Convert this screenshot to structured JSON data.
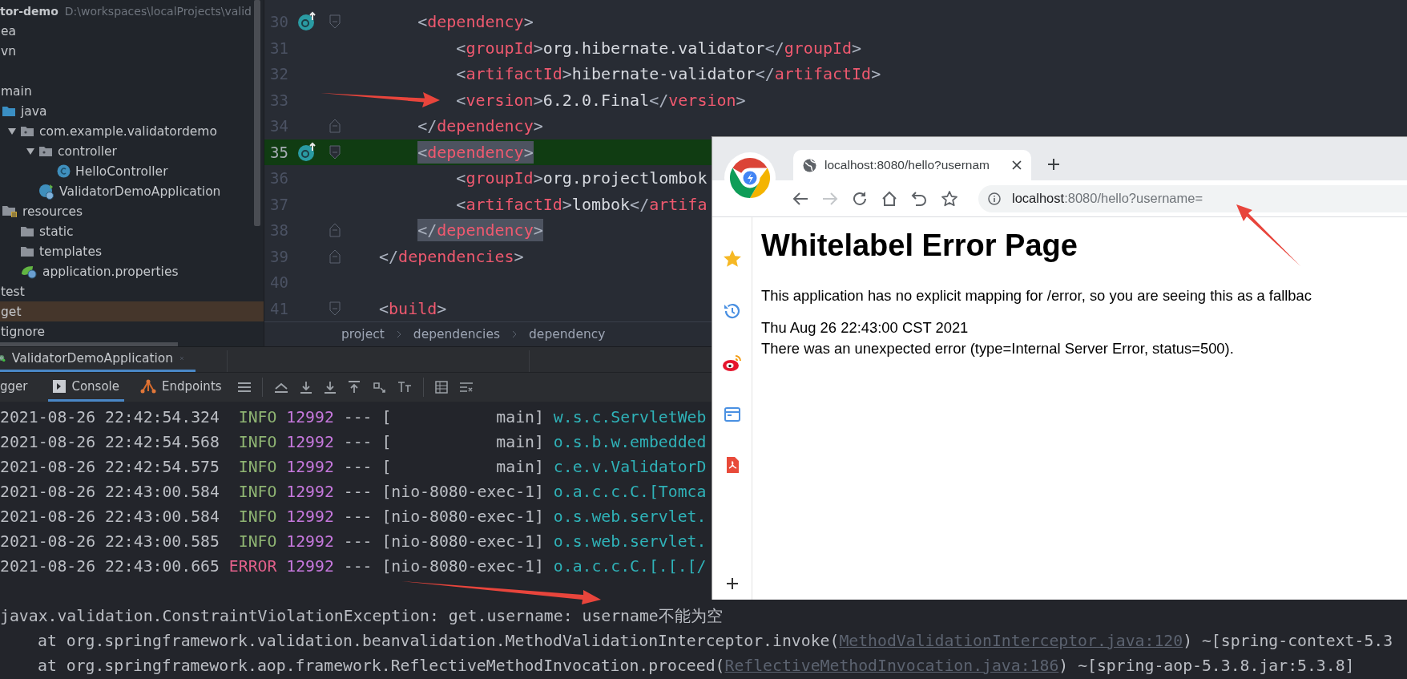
{
  "project": {
    "name": "tor-demo",
    "path": "D:\\workspaces\\localProjects\\valid",
    "tree": [
      {
        "label": "ea",
        "selected": false
      },
      {
        "label": "vn",
        "selected": false
      },
      {
        "label": "main",
        "selected": false,
        "children": [
          {
            "label": "java",
            "kind": "source",
            "selected": false,
            "children": [
              {
                "label": "com.example.validatordemo",
                "kind": "package",
                "expanded": true,
                "selected": false,
                "children": [
                  {
                    "label": "controller",
                    "kind": "package",
                    "expanded": true,
                    "selected": false,
                    "children": [
                      {
                        "label": "HelloController",
                        "kind": "class",
                        "selected": false
                      }
                    ]
                  },
                  {
                    "label": "ValidatorDemoApplication",
                    "kind": "app",
                    "selected": false
                  }
                ]
              }
            ]
          },
          {
            "label": "resources",
            "kind": "resources",
            "selected": false,
            "children": [
              {
                "label": "static",
                "kind": "folder",
                "selected": false
              },
              {
                "label": "templates",
                "kind": "folder",
                "selected": false
              },
              {
                "label": "application.properties",
                "kind": "props",
                "selected": false
              }
            ]
          }
        ]
      },
      {
        "label": "test",
        "selected": false
      },
      {
        "label": "get",
        "selected": true
      },
      {
        "label": "tignore",
        "selected": false
      }
    ]
  },
  "editor": {
    "lines": [
      {
        "number": "30",
        "code": "    <dependency>",
        "gutter_icon": true,
        "kind": "open",
        "current": false,
        "matched": false
      },
      {
        "number": "31",
        "code": "        <groupId>org.hibernate.validator</groupId>",
        "gutter_icon": false,
        "current": false,
        "matched": false
      },
      {
        "number": "32",
        "code": "        <artifactId>hibernate-validator</artifactId>",
        "gutter_icon": false,
        "current": false,
        "matched": false
      },
      {
        "number": "33",
        "code": "        <version>6.2.0.Final</version>",
        "gutter_icon": false,
        "current": false,
        "matched": false
      },
      {
        "number": "34",
        "code": "    </dependency>",
        "gutter_icon": false,
        "kind": "close",
        "current": false,
        "matched": false
      },
      {
        "number": "35",
        "code": "    <dependency>",
        "gutter_icon": true,
        "kind": "open",
        "current": true,
        "matched": true
      },
      {
        "number": "36",
        "code": "        <groupId>org.projectlombok",
        "gutter_icon": false,
        "current": false,
        "matched": false
      },
      {
        "number": "37",
        "code": "        <artifactId>lombok</artifa",
        "gutter_icon": false,
        "current": false,
        "matched": false
      },
      {
        "number": "38",
        "code": "    </dependency>",
        "gutter_icon": false,
        "kind": "close",
        "current": false,
        "matched": true
      },
      {
        "number": "39",
        "code": "</dependencies>",
        "gutter_icon": false,
        "kind": "close",
        "current": false,
        "matched": false
      },
      {
        "number": "40",
        "gutter_icon": false,
        "current": false
      },
      {
        "number": "41",
        "code": "<build>",
        "gutter_icon": false,
        "kind": "open",
        "current": false,
        "matched": false
      }
    ],
    "breadcrumb": [
      "project",
      "dependencies",
      "dependency"
    ]
  },
  "run_panel": {
    "tabs": [
      {
        "label": "ValidatorDemoApplication",
        "selected": true
      }
    ],
    "tool_tabs": [
      {
        "label": "gger",
        "kind": "debugger",
        "selected": false
      },
      {
        "label": "Console",
        "kind": "console",
        "selected": true
      },
      {
        "label": "Endpoints",
        "kind": "endpoints",
        "selected": false
      }
    ]
  },
  "console": {
    "log": [
      {
        "time": "2021-08-26 22:42:54.324",
        "level": "INFO",
        "kind": "info",
        "pid": "12992",
        "sep": "---",
        "thread": "[           main]",
        "logger": "w.s.c.ServletWeb"
      },
      {
        "time": "2021-08-26 22:42:54.568",
        "level": "INFO",
        "kind": "info",
        "pid": "12992",
        "sep": "---",
        "thread": "[           main]",
        "logger": "o.s.b.w.embedded"
      },
      {
        "time": "2021-08-26 22:42:54.575",
        "level": "INFO",
        "kind": "info",
        "pid": "12992",
        "sep": "---",
        "thread": "[           main]",
        "logger": "c.e.v.ValidatorD"
      },
      {
        "time": "2021-08-26 22:43:00.584",
        "level": "INFO",
        "kind": "info",
        "pid": "12992",
        "sep": "---",
        "thread": "[nio-8080-exec-1]",
        "logger": "o.a.c.c.C.[Tomca"
      },
      {
        "time": "2021-08-26 22:43:00.584",
        "level": "INFO",
        "kind": "info",
        "pid": "12992",
        "sep": "---",
        "thread": "[nio-8080-exec-1]",
        "logger": "o.s.web.servlet."
      },
      {
        "time": "2021-08-26 22:43:00.585",
        "level": "INFO",
        "kind": "info",
        "pid": "12992",
        "sep": "---",
        "thread": "[nio-8080-exec-1]",
        "logger": "o.s.web.servlet."
      },
      {
        "time": "2021-08-26 22:43:00.665",
        "level": "ERROR",
        "kind": "error",
        "pid": "12992",
        "sep": "---",
        "thread": "[nio-8080-exec-1]",
        "logger": "o.a.c.c.C.[.[.[/"
      }
    ],
    "trace": [
      {
        "kind": "exception",
        "text": "javax.validation.ConstraintViolationException: get.username: username不能为空"
      },
      {
        "kind": "frame",
        "text": "at org.springframework.validation.beanvalidation.MethodValidationInterceptor.invoke(",
        "link": "MethodValidationInterceptor.java:120",
        "rest": ") ~[spring-context-5.3"
      },
      {
        "kind": "frame",
        "text": "at org.springframework.aop.framework.ReflectiveMethodInvocation.proceed(",
        "link": "ReflectiveMethodInvocation.java:186",
        "rest": ") ~[spring-aop-5.3.8.jar:5.3.8]"
      }
    ]
  },
  "browser": {
    "tab": {
      "title": "localhost:8080/hello?usernam",
      "selected": true
    },
    "forward_enabled": false,
    "address": {
      "host": "localhost",
      "path": ":8080/hello?username="
    },
    "page": {
      "heading": "Whitelabel Error Page",
      "message": "This application has no explicit mapping for /error, so you are seeing this as a fallbac",
      "timestamp": "Thu Aug 26 22:43:00 CST 2021",
      "error": "There was an unexpected error (type=Internal Server Error, status=500)."
    }
  }
}
